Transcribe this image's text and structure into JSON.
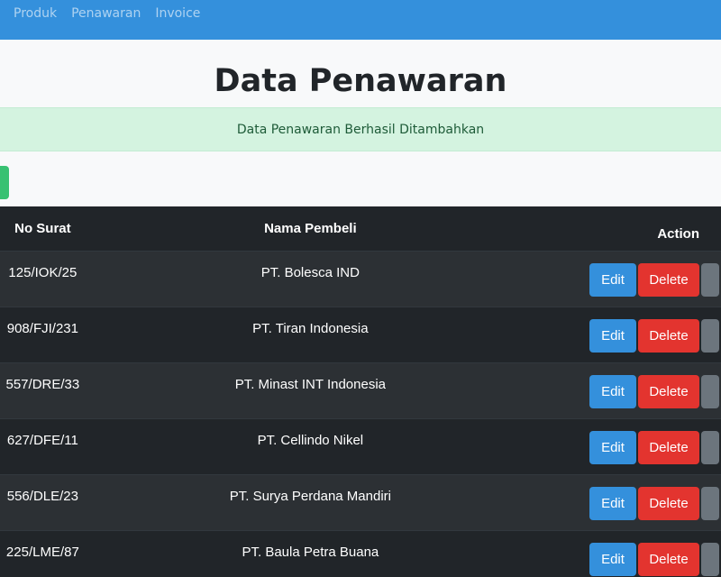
{
  "nav": {
    "items": [
      "Produk",
      "Penawaran",
      "Invoice"
    ]
  },
  "page": {
    "title": "Data Penawaran"
  },
  "alert": {
    "message": "Data Penawaran Berhasil Ditambahkan"
  },
  "table": {
    "headers": [
      "No Surat",
      "Nama Pembeli",
      "Action"
    ],
    "rows": [
      {
        "no_surat": "125/IOK/25",
        "nama": "PT. Bolesca IND"
      },
      {
        "no_surat": "908/FJI/231",
        "nama": "PT. Tiran Indonesia"
      },
      {
        "no_surat": "557/DRE/33",
        "nama": "PT. Minast INT Indonesia"
      },
      {
        "no_surat": "627/DFE/11",
        "nama": "PT. Cellindo Nikel"
      },
      {
        "no_surat": "556/DLE/23",
        "nama": "PT. Surya Perdana Mandiri"
      },
      {
        "no_surat": "225/LME/87",
        "nama": "PT. Baula Petra Buana"
      }
    ],
    "actions": {
      "edit": "Edit",
      "delete": "Delete"
    }
  },
  "colors": {
    "navbar": "#3490dc",
    "alert_bg": "#d4f3e0",
    "add_button": "#38c172",
    "table_dark": "#212529",
    "edit": "#3490dc",
    "delete": "#e3342f",
    "extra": "#6c757d"
  }
}
